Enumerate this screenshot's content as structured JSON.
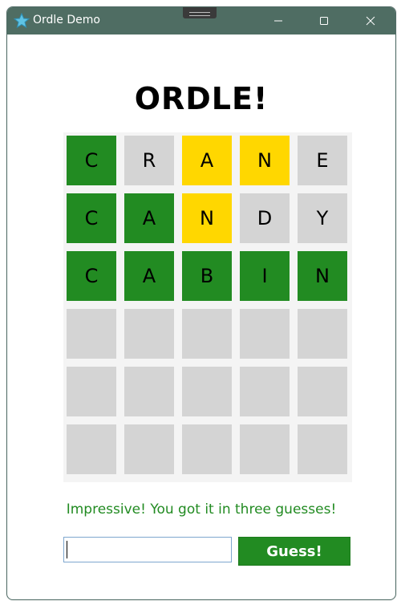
{
  "window": {
    "title": "Ordle Demo",
    "icon": "star-icon",
    "titlebar_color": "#4f6d63"
  },
  "heading": "ORDLE!",
  "colors": {
    "correct": "#228b22",
    "present": "#ffd700",
    "absent": "#d4d4d4",
    "empty": "#d4d4d4",
    "message": "#228b22"
  },
  "board": {
    "rows": [
      [
        {
          "letter": "C",
          "state": "correct"
        },
        {
          "letter": "R",
          "state": "absent"
        },
        {
          "letter": "A",
          "state": "present"
        },
        {
          "letter": "N",
          "state": "present"
        },
        {
          "letter": "E",
          "state": "absent"
        }
      ],
      [
        {
          "letter": "C",
          "state": "correct"
        },
        {
          "letter": "A",
          "state": "correct"
        },
        {
          "letter": "N",
          "state": "present"
        },
        {
          "letter": "D",
          "state": "absent"
        },
        {
          "letter": "Y",
          "state": "absent"
        }
      ],
      [
        {
          "letter": "C",
          "state": "correct"
        },
        {
          "letter": "A",
          "state": "correct"
        },
        {
          "letter": "B",
          "state": "correct"
        },
        {
          "letter": "I",
          "state": "correct"
        },
        {
          "letter": "N",
          "state": "correct"
        }
      ],
      [
        {
          "letter": "",
          "state": "empty"
        },
        {
          "letter": "",
          "state": "empty"
        },
        {
          "letter": "",
          "state": "empty"
        },
        {
          "letter": "",
          "state": "empty"
        },
        {
          "letter": "",
          "state": "empty"
        }
      ],
      [
        {
          "letter": "",
          "state": "empty"
        },
        {
          "letter": "",
          "state": "empty"
        },
        {
          "letter": "",
          "state": "empty"
        },
        {
          "letter": "",
          "state": "empty"
        },
        {
          "letter": "",
          "state": "empty"
        }
      ],
      [
        {
          "letter": "",
          "state": "empty"
        },
        {
          "letter": "",
          "state": "empty"
        },
        {
          "letter": "",
          "state": "empty"
        },
        {
          "letter": "",
          "state": "empty"
        },
        {
          "letter": "",
          "state": "empty"
        }
      ]
    ]
  },
  "message": "Impressive! You got it in three guesses!",
  "input": {
    "value": "",
    "placeholder": ""
  },
  "guess_button_label": "Guess!"
}
